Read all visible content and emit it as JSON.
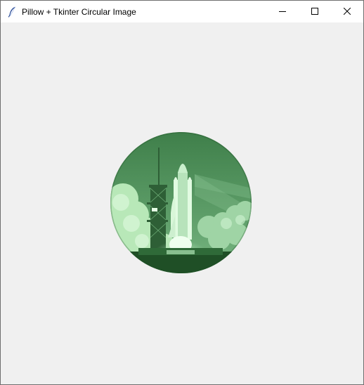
{
  "window": {
    "title": "Pillow + Tkinter Circular Image",
    "app_icon": "feather-icon",
    "controls": {
      "minimize_icon": "minimize-icon",
      "maximize_icon": "maximize-icon",
      "close_icon": "close-icon"
    }
  },
  "content": {
    "image": {
      "subject": "space-shuttle-launch",
      "shape": "circle",
      "tint_color": "#5aa366"
    }
  },
  "colors": {
    "background": "#f0f0f0",
    "titlebar": "#ffffff",
    "tint_dark": "#1f4f26",
    "tint_light": "#d6f5d6"
  }
}
